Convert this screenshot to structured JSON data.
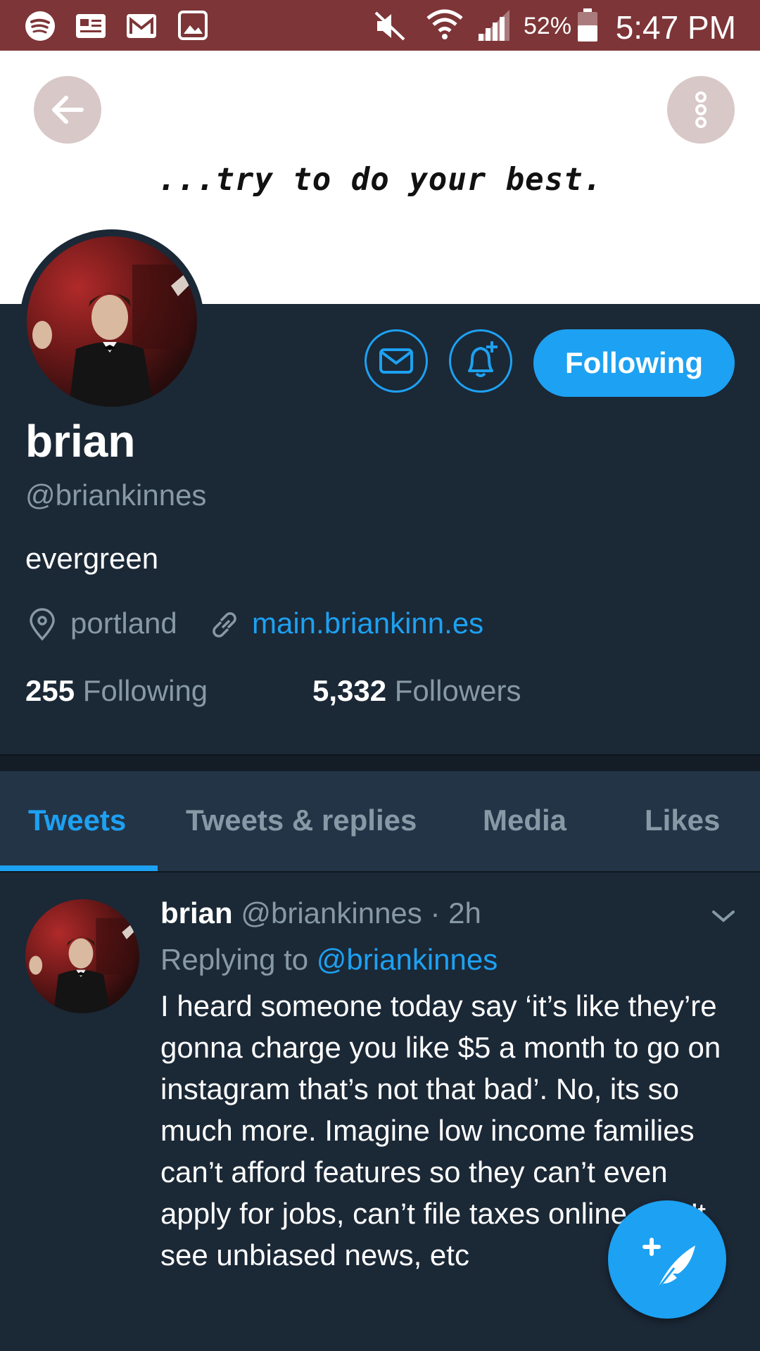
{
  "status_bar": {
    "battery_percent": "52%",
    "time": "5:47 PM"
  },
  "header": {
    "banner_quote": "...try to do your best."
  },
  "profile": {
    "display_name": "brian",
    "handle": "@briankinnes",
    "bio": "evergreen",
    "location": "portland",
    "website": "main.briankinn.es",
    "follow_button_label": "Following",
    "following_count": "255",
    "following_label": "Following",
    "followers_count": "5,332",
    "followers_label": "Followers"
  },
  "tabs": [
    {
      "label": "Tweets",
      "active": true
    },
    {
      "label": "Tweets & replies",
      "active": false
    },
    {
      "label": "Media",
      "active": false
    },
    {
      "label": "Likes",
      "active": false
    }
  ],
  "tweet": {
    "name": "brian",
    "handle": "@briankinnes",
    "separator": "·",
    "time": "2h",
    "replying_prefix": "Replying to",
    "replying_to": "@briankinnes",
    "text": "I heard someone today say ‘it’s like they’re gonna charge you like $5 a month to go on instagram that’s not that bad’. No, its so much more. Imagine low income families can’t afford features so they can’t even apply for jobs, can’t file taxes online, can’t see unbiased news, etc"
  },
  "colors": {
    "accent": "#1da1f2",
    "status_bar": "#7d3537",
    "background": "#1b2836",
    "tab_bar": "#243447",
    "muted_text": "#8899a6"
  },
  "icons": {
    "back": "arrow-left-icon",
    "more": "more-vertical-icon",
    "message": "envelope-icon",
    "notify": "bell-plus-icon",
    "location": "location-pin-icon",
    "link": "link-icon",
    "caret": "chevron-down-icon",
    "compose": "feather-plus-icon"
  }
}
